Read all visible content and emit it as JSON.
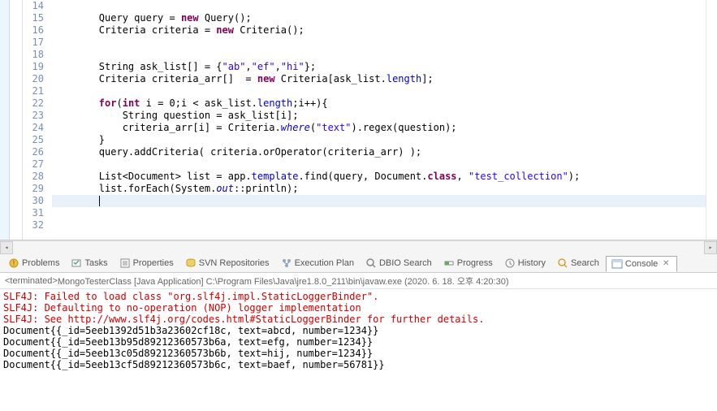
{
  "editor": {
    "first_line": 14,
    "last_line": 32,
    "highlight_line": 30,
    "lines": {
      "l15": {
        "pre": "        Query query = ",
        "kw1": "new",
        "post": " Query();"
      },
      "l16": {
        "pre": "        Criteria criteria = ",
        "kw1": "new",
        "post": " Criteria();"
      },
      "l19": {
        "pre": "        String ask_list[] = {",
        "s1": "\"ab\"",
        "c1": ",",
        "s2": "\"ef\"",
        "c2": ",",
        "s3": "\"hi\"",
        "post": "};"
      },
      "l20": {
        "pre": "        Criteria criteria_arr[]  = ",
        "kw1": "new",
        "mid": " Criteria[ask_list.",
        "fld": "length",
        "post": "];"
      },
      "l22": {
        "kw1": "for",
        "pre2": "(",
        "kw2": "int",
        "mid": " i = 0;i < ask_list.",
        "fld": "length",
        "post": ";i++){"
      },
      "l23": {
        "text": "            String question = ask_list[i];"
      },
      "l24": {
        "pre": "            criteria_arr[i] = Criteria.",
        "sta": "where",
        "p1": "(",
        "s1": "\"text\"",
        "p2": ").regex(question);"
      },
      "l25": {
        "text": "        }"
      },
      "l26": {
        "text": "        query.addCriteria( criteria.orOperator(criteria_arr) );"
      },
      "l28": {
        "pre": "        List<Document> list = app.",
        "fld": "template",
        "mid": ".find(query, Document.",
        "kw1": "class",
        "c1": ", ",
        "s1": "\"test_collection\"",
        "post": ");"
      },
      "l29": {
        "pre": "        list.forEach(System.",
        "sta": "out",
        "post": "::println);"
      }
    }
  },
  "tabs": {
    "items": [
      {
        "label": "Problems",
        "icon": "problems-icon"
      },
      {
        "label": "Tasks",
        "icon": "tasks-icon"
      },
      {
        "label": "Properties",
        "icon": "properties-icon"
      },
      {
        "label": "SVN Repositories",
        "icon": "svn-icon"
      },
      {
        "label": "Execution Plan",
        "icon": "execplan-icon"
      },
      {
        "label": "DBIO Search",
        "icon": "dbio-icon"
      },
      {
        "label": "Progress",
        "icon": "progress-icon"
      },
      {
        "label": "History",
        "icon": "history-icon"
      },
      {
        "label": "Search",
        "icon": "search-icon"
      },
      {
        "label": "Console",
        "icon": "console-icon",
        "active": true
      }
    ]
  },
  "console": {
    "status_prefix": "<terminated>",
    "status_main": " MongoTesterClass [Java Application] C:\\Program Files\\Java\\jre1.8.0_211\\bin\\javaw.exe (2020. 6. 18. 오후 4:20:30)",
    "lines": [
      {
        "err": true,
        "text": "SLF4J: Failed to load class \"org.slf4j.impl.StaticLoggerBinder\"."
      },
      {
        "err": true,
        "text": "SLF4J: Defaulting to no-operation (NOP) logger implementation"
      },
      {
        "err": true,
        "text": "SLF4J: See http://www.slf4j.org/codes.html#StaticLoggerBinder for further details."
      },
      {
        "err": false,
        "text": "Document{{_id=5eeb1392d51b3a23602cf18c, text=abcd, number=1234}}"
      },
      {
        "err": false,
        "text": "Document{{_id=5eeb13b95d89212360573b6a, text=efg, number=1234}}"
      },
      {
        "err": false,
        "text": "Document{{_id=5eeb13c05d89212360573b6b, text=hij, number=1234}}"
      },
      {
        "err": false,
        "text": "Document{{_id=5eeb13cf5d89212360573b6c, text=baef, number=56781}}"
      }
    ]
  }
}
